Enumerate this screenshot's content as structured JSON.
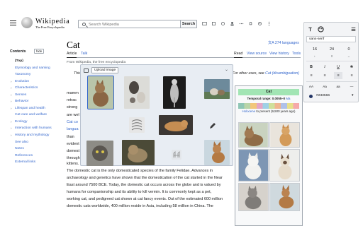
{
  "header": {
    "wordmark": "Wikipedia",
    "tagline": "The Free Encyclopedia",
    "search_placeholder": "Search Wikipedia",
    "search_button": "Search"
  },
  "toc": {
    "heading": "Contents",
    "hide_label": "hide",
    "items": [
      {
        "label": "(Top)",
        "expandable": false
      },
      {
        "label": "Etymology and naming",
        "expandable": false
      },
      {
        "label": "Taxonomy",
        "expandable": false
      },
      {
        "label": "Evolution",
        "expandable": true
      },
      {
        "label": "Characteristics",
        "expandable": true
      },
      {
        "label": "Senses",
        "expandable": true
      },
      {
        "label": "Behavior",
        "expandable": true
      },
      {
        "label": "Lifespan and health",
        "expandable": true
      },
      {
        "label": "Cat care and welfare",
        "expandable": false
      },
      {
        "label": "Ecology",
        "expandable": true
      },
      {
        "label": "Interaction with humans",
        "expandable": true
      },
      {
        "label": "History and mythology",
        "expandable": true
      },
      {
        "label": "See also",
        "expandable": false
      },
      {
        "label": "Notes",
        "expandable": false
      },
      {
        "label": "References",
        "expandable": false
      },
      {
        "label": "External links",
        "expandable": false
      }
    ]
  },
  "article": {
    "title": "Cat",
    "languages": "274 languages",
    "tabs_left": [
      "Article",
      "Talk"
    ],
    "tabs_right": [
      "Read",
      "View source",
      "View history",
      "Tools"
    ],
    "from": "From Wikipedia, the free encyclopedia",
    "hatnote_start": "This",
    "hatnote_end": "For other uses, see",
    "hatnote_link": "Cat (disambiguation)",
    "fragments": [
      "mamm",
      "retrac",
      "strong",
      "are wel",
      "Cat co",
      "langua",
      "than",
      "evident",
      "domest",
      "through",
      "kittens."
    ],
    "lead": [
      {
        "text": "The domestic cat is the only ",
        "link": "domesticated species",
        "rest": " of the family ",
        "link2": "Felidae",
        "rest2": ". Advances in"
      },
      {
        "text": "",
        "link": "archaeology",
        "rest": " and ",
        "link2": "genetics",
        "rest2": " have shown that the "
      },
      {
        "text": "",
        "link": "",
        "rest": "",
        "link2": "",
        "rest2": ""
      }
    ],
    "lead_lines": [
      "The domestic cat is the only domesticated species of the family Felidae. Advances in",
      "archaeology and genetics have shown that the domestication of the cat started in the Near",
      "East around 7500 BCE. Today, the domestic cat occurs across the globe and is valued by",
      "humans for companionship and its ability to kill vermin. It is commonly kept as a pet,",
      "working cat, and pedigreed cat shown at cat fancy events. Out of the estimated 600 million",
      "domestic cats worldwide, 400 million reside in Asia, including 58 million in China. The"
    ]
  },
  "infobox": {
    "title": "Cat",
    "range_label": "Temporal range: 0.0055–0",
    "range_unit": "Ma",
    "holocene_link": "Holocene",
    "holocene_rest": "to present (9,500 years ago)"
  },
  "picker": {
    "upload_label": "Upload image"
  },
  "panel": {
    "font": "sans-serif",
    "size": "16",
    "line_height": "24",
    "padding": "0",
    "color_hex": "#233566",
    "colors": {
      "swatch": "#233566"
    }
  }
}
